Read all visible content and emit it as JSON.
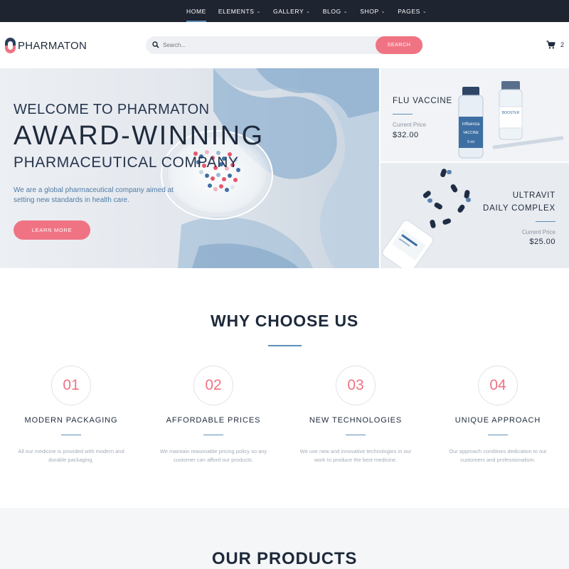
{
  "nav": {
    "items": [
      {
        "label": "HOME",
        "has_dropdown": false,
        "active": true
      },
      {
        "label": "ELEMENTS",
        "has_dropdown": true
      },
      {
        "label": "GALLERY",
        "has_dropdown": true
      },
      {
        "label": "BLOG",
        "has_dropdown": true
      },
      {
        "label": "SHOP",
        "has_dropdown": true
      },
      {
        "label": "PAGES",
        "has_dropdown": true
      }
    ]
  },
  "header": {
    "logo_text": "PHARMATON",
    "search_placeholder": "Search...",
    "search_button": "SEARCH",
    "cart_count": "2"
  },
  "hero": {
    "kicker": "WELCOME TO PHARMATON",
    "headline": "AWARD-WINNING",
    "subheadline": "PHARMACEUTICAL COMPANY",
    "description": "We are a global pharmaceutical company aimed at setting new standards in health care.",
    "button": "LEARN MORE"
  },
  "promos": [
    {
      "title_line1": "FLU VACCINE",
      "title_line2": "",
      "price_label": "Current Price",
      "price": "$32.00",
      "vial_label": "Influenza",
      "vial_sub": "VACCINE",
      "vial_dose": "5 ml",
      "vial2_label": "BOOSTER"
    },
    {
      "title_line1": "ULTRAVIT",
      "title_line2": "DAILY COMPLEX",
      "price_label": "Current Price",
      "price": "$25.00"
    }
  ],
  "why": {
    "title": "WHY CHOOSE US",
    "features": [
      {
        "number": "01",
        "title": "MODERN PACKAGING",
        "text": "All our medicine is provided with modern and durable packaging."
      },
      {
        "number": "02",
        "title": "AFFORDABLE PRICES",
        "text": "We maintain reasonable pricing policy so any customer can afford our products."
      },
      {
        "number": "03",
        "title": "NEW TECHNOLOGIES",
        "text": "We use new and innovative technologies in our work to produce the best medicine."
      },
      {
        "number": "04",
        "title": "UNIQUE APPROACH",
        "text": "Our approach combines dedication to our customers and professionalism."
      }
    ]
  },
  "products": {
    "title": "OUR PRODUCTS"
  },
  "colors": {
    "accent_pink": "#f07384",
    "accent_blue": "#5f8fb8",
    "dark": "#1e2a3b",
    "nav_bg": "#1f2431"
  }
}
